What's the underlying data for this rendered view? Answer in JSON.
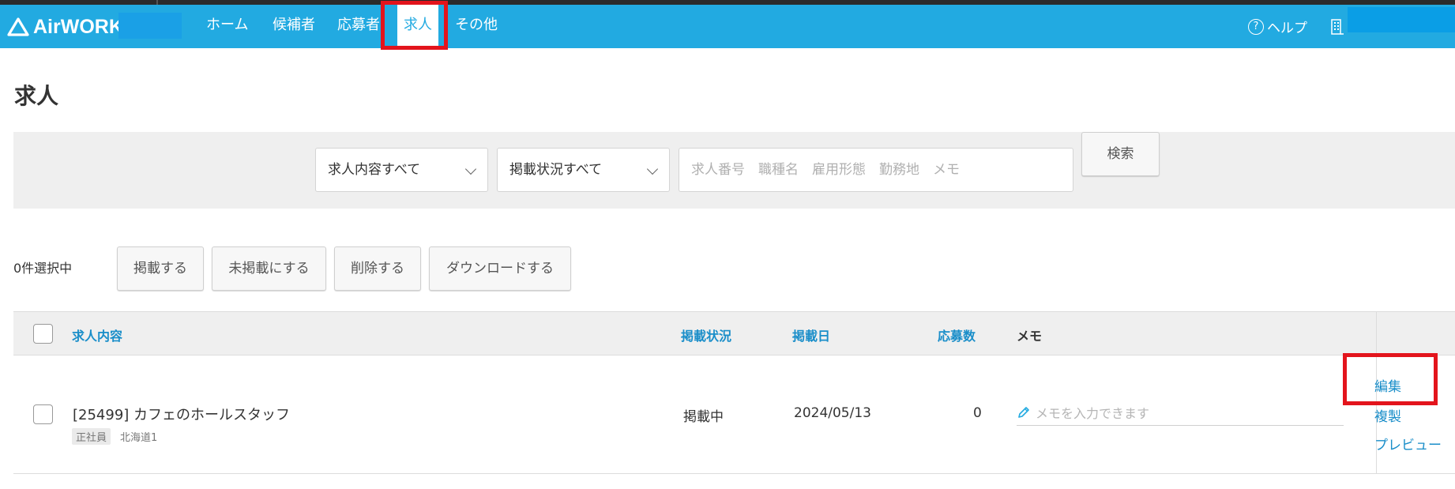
{
  "brand": {
    "name": "AirWORK",
    "color": "#22aae1"
  },
  "nav": {
    "items": [
      {
        "label": "ホーム"
      },
      {
        "label": "候補者"
      },
      {
        "label": "応募者"
      },
      {
        "label": "求人",
        "active": true
      },
      {
        "label": "その他"
      }
    ],
    "help_icon": "question-circle-icon",
    "help_label": "ヘルプ",
    "user_icon": "building-icon"
  },
  "page": {
    "title": "求人"
  },
  "filters": {
    "content_select": "求人内容すべて",
    "status_select": "掲載状況すべて",
    "search_placeholder": "求人番号　職種名　雇用形態　勤務地　メモ",
    "search_value": "",
    "search_button": "検索"
  },
  "bulk": {
    "selected_count": "0件選択中",
    "publish": "掲載する",
    "unpublish": "未掲載にする",
    "delete": "削除する",
    "download": "ダウンロードする"
  },
  "table": {
    "columns": {
      "content": "求人内容",
      "status": "掲載状況",
      "date": "掲載日",
      "applicants": "応募数",
      "memo": "メモ"
    },
    "rows": [
      {
        "title": "[25499] カフェのホールスタッフ",
        "employment_type": "正社員",
        "location": "北海道1",
        "status": "掲載中",
        "date": "2024/05/13",
        "applicants": "0",
        "memo_placeholder": "メモを入力できます",
        "actions": {
          "edit": "編集",
          "duplicate": "複製",
          "preview": "プレビュー"
        }
      }
    ]
  },
  "highlight_color": "#e3141c"
}
